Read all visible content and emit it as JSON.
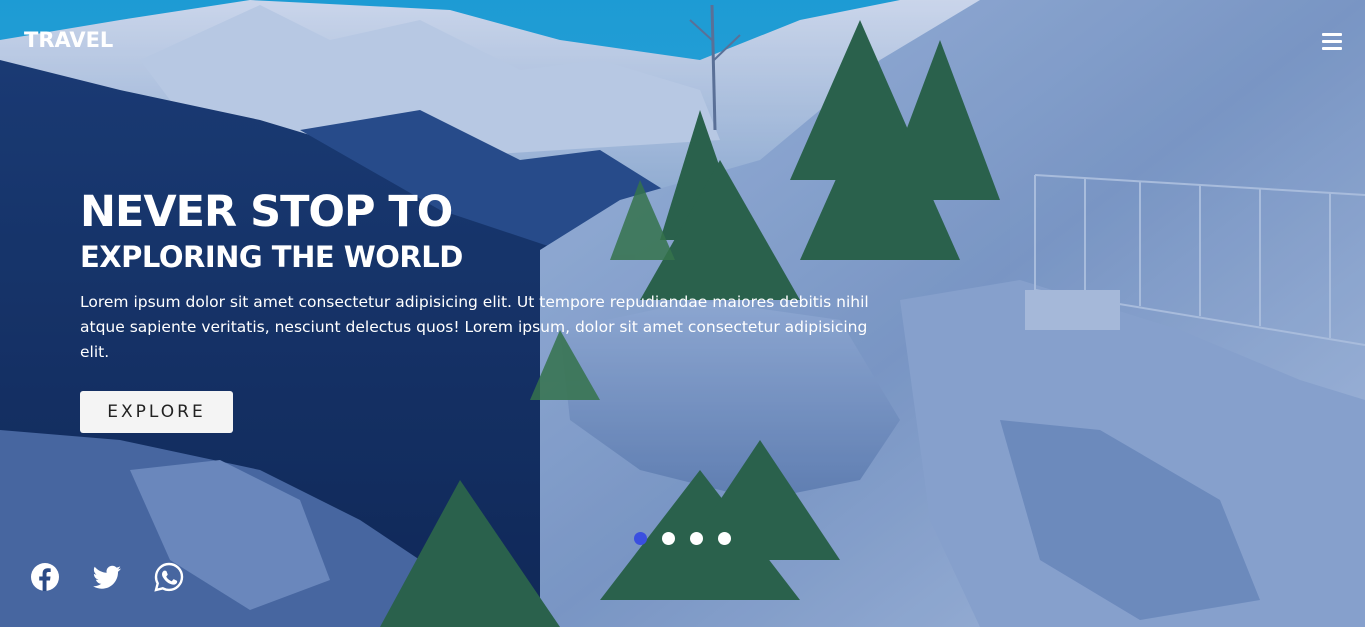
{
  "brand": {
    "logo": "TRAVEL"
  },
  "nav": {
    "menu_icon": "hamburger-menu-icon"
  },
  "hero": {
    "title_line1": "NEVER STOP TO",
    "title_line2": "EXPLORING THE WORLD",
    "description": "Lorem ipsum dolor sit amet consectetur adipisicing elit. Ut tempore repudiandae maiores debitis nihil atque sapiente veritatis, nesciunt delectus quos! Lorem ipsum, dolor sit amet consectetur adipisicing elit.",
    "cta_label": "EXPLORE"
  },
  "carousel": {
    "slide_count": 4,
    "active_index": 0,
    "active_color": "#3a4fe0"
  },
  "social": [
    "facebook-icon",
    "twitter-icon",
    "whatsapp-icon"
  ],
  "colors": {
    "text": "#ffffff",
    "button_bg": "#f4f4f4"
  }
}
